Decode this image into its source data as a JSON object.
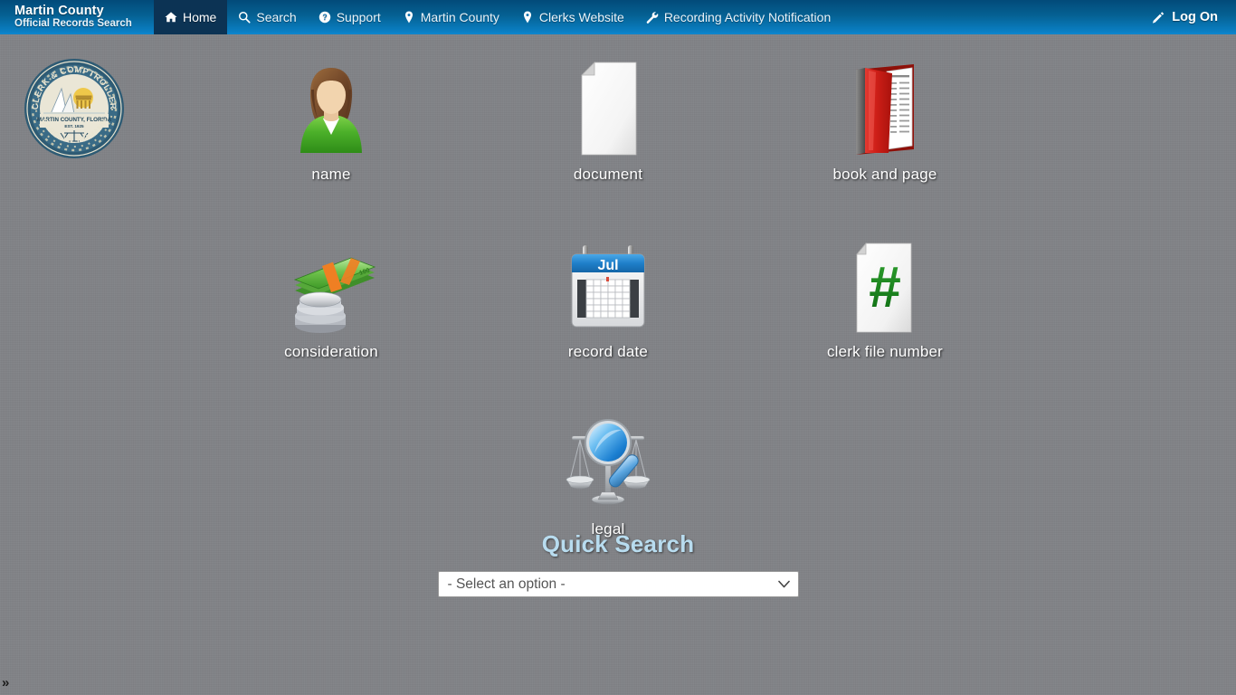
{
  "navbar": {
    "brand_line1": "Martin County",
    "brand_line2": "Official Records Search",
    "items": [
      {
        "label": "Home",
        "icon": "home-icon",
        "active": true
      },
      {
        "label": "Search",
        "icon": "search-icon",
        "active": false
      },
      {
        "label": "Support",
        "icon": "question-circle-icon",
        "active": false
      },
      {
        "label": "Martin County",
        "icon": "map-pin-icon",
        "active": false
      },
      {
        "label": "Clerks Website",
        "icon": "map-pin-icon",
        "active": false
      },
      {
        "label": "Recording Activity Notification",
        "icon": "wrench-icon",
        "active": false
      }
    ],
    "logon_label": "Log On",
    "logon_icon": "pencil-icon",
    "gradient_top": "#024a79",
    "gradient_bottom": "#0e87cf",
    "active_tab_color": "#0c3354"
  },
  "seal": {
    "name": "clerk-comptroller-seal",
    "outer_text": "CLERK & COMPTROLLER",
    "bottom_text": "CAROLYN TIMMANN",
    "center_line1": "MARTIN COUNTY, FLORIDA",
    "center_line2": "EST. 1925"
  },
  "search_tiles": [
    {
      "label": "name",
      "icon": "person-avatar-icon"
    },
    {
      "label": "document",
      "icon": "document-page-icon"
    },
    {
      "label": "book and page",
      "icon": "red-book-icon"
    },
    {
      "label": "consideration",
      "icon": "money-cash-icon"
    },
    {
      "label": "record date",
      "icon": "calendar-icon"
    },
    {
      "label": "clerk file number",
      "icon": "hash-document-icon"
    },
    {
      "label": "legal",
      "icon": "scales-magnifier-icon"
    }
  ],
  "calendar": {
    "month_label": "Jul"
  },
  "quick_search": {
    "title": "Quick Search",
    "select_value": "- Select an option -",
    "caret_icon": "chevron-down-icon"
  },
  "footer": {
    "expand_label": "»"
  },
  "colors": {
    "page_background": "#818387",
    "title_blue": "#b8dcef",
    "label_white": "#ffffff"
  }
}
